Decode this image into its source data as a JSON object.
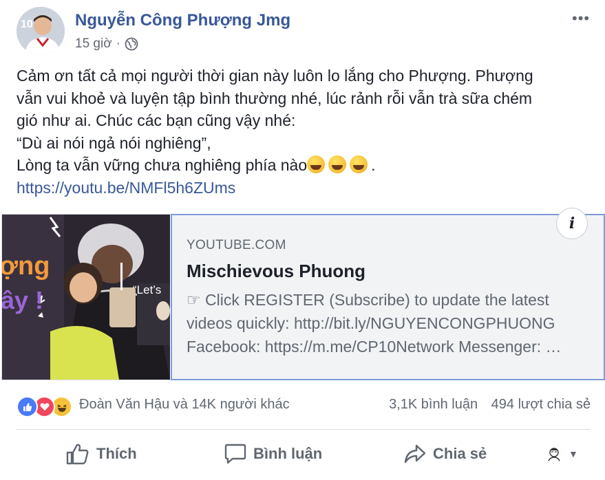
{
  "post": {
    "author": "Nguyễn Công Phượng Jmg",
    "time": "15 giờ",
    "separator": "·",
    "privacy_icon": "globe-icon",
    "more_label": "•••",
    "lines": [
      "Cảm ơn tất cả mọi người thời gian này luôn lo lắng cho Phượng. Phượng",
      "vẫn vui khoẻ và luyện tập bình thường nhé, lúc rảnh rỗi vẫn trà sữa chém",
      "gió như ai. Chúc các bạn cũng vậy nhé:",
      "“Dù ai nói ngả nói nghiêng”,",
      "Lòng ta vẫn vững chưa nghiêng phía nào"
    ],
    "trailing_emoji": "rolling-on-floor-laughing-emoji",
    "trailing_punct": ".",
    "link": "https://youtu.be/NMFl5h6ZUms"
  },
  "preview": {
    "thumbnail_text_1": "ợng",
    "thumbnail_text_2": "ây !",
    "thumbnail_text_3": "“Let’s",
    "source": "YOUTUBE.COM",
    "title": "Mischievous Phuong",
    "desc_lines": [
      "☞ Click REGISTER (Subscribe) to update the latest",
      "videos quickly: http://bit.ly/NGUYENCONGPHUONG",
      "Facebook: https://m.me/CP10Network Messenger: …"
    ],
    "info_label": "i"
  },
  "reactions": {
    "icons": [
      "like-icon",
      "love-icon",
      "haha-icon"
    ],
    "names": "Đoàn Văn Hậu và 14K người khác",
    "comments": "3,1K bình luận",
    "shares": "494 lượt chia sẻ"
  },
  "actions": {
    "like": "Thích",
    "comment": "Bình luận",
    "share": "Chia sẻ"
  },
  "colors": {
    "author": "#385898",
    "link": "#385898",
    "like_blue": "#4a7af6",
    "love_red": "#f0475c",
    "haha_yellow": "#f7c23a",
    "preview_border": "#7d9ad9"
  }
}
